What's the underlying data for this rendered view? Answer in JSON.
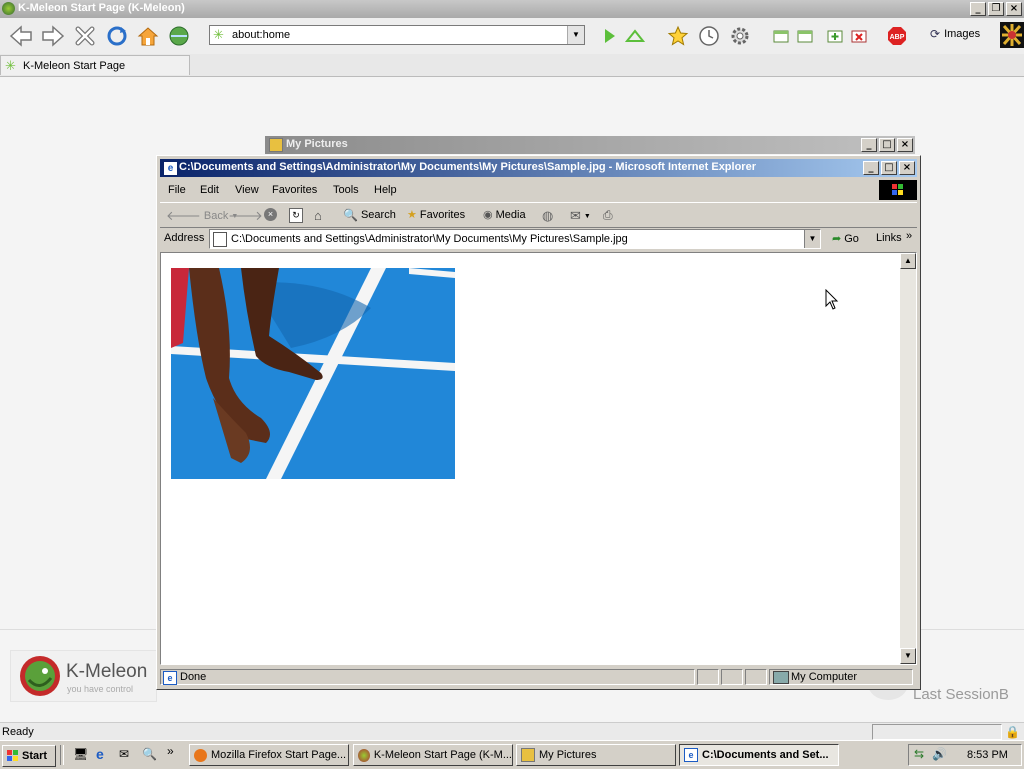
{
  "kmeleon": {
    "title": "K-Meleon Start Page (K-Meleon)",
    "url": "about:home",
    "tab_label": "K-Meleon Start Page",
    "images_label": "Images",
    "logo_name": "K-Meleon",
    "logo_tagline": "you have control",
    "last_session_label": "Last SessionB",
    "status_text": "Ready"
  },
  "my_pictures": {
    "title": "My Pictures"
  },
  "ie": {
    "title": "C:\\Documents and Settings\\Administrator\\My Documents\\My Pictures\\Sample.jpg - Microsoft Internet Explorer",
    "menu": [
      "File",
      "Edit",
      "View",
      "Favorites",
      "Tools",
      "Help"
    ],
    "toolbar": {
      "back": "Back",
      "search": "Search",
      "favorites": "Favorites",
      "media": "Media"
    },
    "address_label": "Address",
    "address_value": "C:\\Documents and Settings\\Administrator\\My Documents\\My Pictures\\Sample.jpg",
    "go_label": "Go",
    "links_label": "Links",
    "status_done": "Done",
    "status_zone": "My Computer"
  },
  "taskbar": {
    "start_label": "Start",
    "tasks": [
      "Mozilla Firefox Start Page...",
      "K-Meleon Start Page (K-M...",
      "My Pictures",
      "C:\\Documents and Set..."
    ],
    "clock": "8:53 PM"
  },
  "colors": {
    "ie_title_active": "#0a246a",
    "win_face": "#d4d0c8",
    "track_blue": "#1f7fd0"
  }
}
